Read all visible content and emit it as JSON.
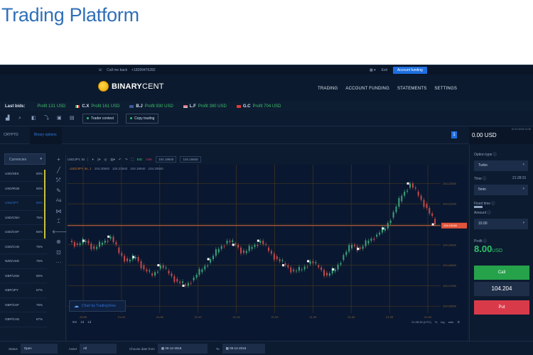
{
  "page_title": "Trading Platform",
  "topbar": {
    "call_label": "Call me back",
    "phone": "+18299476282",
    "exit_label": "Exit",
    "account_funding_button": "Account funding"
  },
  "brand": {
    "name_bold": "BINARY",
    "name_light": "CENT"
  },
  "nav": [
    "TRADING",
    "ACCOUNT FUNDING",
    "STATEMENTS",
    "SETTINGS"
  ],
  "last_bids": {
    "label": "Last bids:",
    "items": [
      {
        "name": "",
        "text": "Profit 131 USD",
        "flag": ""
      },
      {
        "name": "C.X",
        "text": "Profit 161 USD",
        "flag": "#e8ded0"
      },
      {
        "name": "B.J",
        "text": "Profit 930 USD",
        "flag": "#3b5998"
      },
      {
        "name": "L.F",
        "text": "Profit 390 USD",
        "flag": "#c5364a"
      },
      {
        "name": "G.C",
        "text": "Profit 704 USD",
        "flag": "#e03a3a"
      }
    ]
  },
  "toolbar": {
    "trader_contest": "Trader contest",
    "copy_trading": "Copy trading"
  },
  "tabs": [
    "CRYPTO",
    "Binary options"
  ],
  "balance": {
    "amount": "0.00 USD",
    "badge": "1",
    "date": "02.10.2018 21:28"
  },
  "currencies": {
    "selector": "Currencies",
    "items": [
      {
        "pair": "USD/SEK",
        "pct": "60%"
      },
      {
        "pair": "USD/RUB",
        "pct": "50%"
      },
      {
        "pair": "USD/JPY",
        "pct": "80%",
        "active": true
      },
      {
        "pair": "USD/CNH",
        "pct": "75%"
      },
      {
        "pair": "USD/CHF",
        "pct": "65%"
      },
      {
        "pair": "USD/CAD",
        "pct": "75%"
      },
      {
        "pair": "NZD/USD",
        "pct": "75%"
      },
      {
        "pair": "GBP/USD",
        "pct": "80%"
      },
      {
        "pair": "GBP/JPY",
        "pct": "67%"
      },
      {
        "pair": "GBP/CHF",
        "pct": "75%"
      },
      {
        "pair": "GBP/CAD",
        "pct": "67%"
      }
    ]
  },
  "chart_toolbar": {
    "symbol": "USDJPY, 5s",
    "buy": "BID",
    "sell": "ASK",
    "v1": "104.19840",
    "v2": "104.16840"
  },
  "chart_legend": {
    "symbol": "USD/JPY, 5s, 1",
    "o": "104.20840",
    "h": "104.21840",
    "l": "104.19940",
    "c": "104.20840"
  },
  "current_price_label": "104.19940",
  "chart_footer": {
    "tradingview": "Chart by TradingView",
    "timeframes": [
      "5m",
      "1d",
      "1d"
    ],
    "utc": "21:28:30 (UTC)",
    "pct": "%",
    "log": "log",
    "auto": "auto"
  },
  "right_panel": {
    "option_type_label": "Option type",
    "option_type": "Turbo",
    "time_label": "Time",
    "time_clock": "21:28:31",
    "time_value": "5min",
    "fixed_time_label": "Fixed time",
    "amount_label": "Amount",
    "amount_value": "10.00",
    "profit_label": "Profit",
    "profit_value": "8.00",
    "profit_currency": "USD",
    "call_button": "Call",
    "price": "104.204",
    "put_button": "Put"
  },
  "bottom_filters": {
    "status_label": "Status",
    "status_value": "Open",
    "asset_label": "Asset",
    "asset_value": "All",
    "date_from_label": "Choose date from",
    "date_from": "09-12-2018",
    "to_label": "To",
    "date_to": "09-12-2018"
  },
  "chart_data": {
    "type": "candlestick",
    "symbol": "USD/JPY",
    "y_ticks": [
      "104.22000",
      "104.21000",
      "104.20000",
      "104.19000",
      "104.18000",
      "104.17000",
      "104.16000"
    ],
    "x_ticks": [
      "20:55",
      "21:00",
      "21:05",
      "21:10",
      "21:15",
      "21:20",
      "21:25",
      "21:30",
      "21:35",
      "21:40"
    ],
    "current_price": 104.1994,
    "closes": [
      104.19,
      104.192,
      104.188,
      104.191,
      104.194,
      104.186,
      104.182,
      104.184,
      104.178,
      104.175,
      104.18,
      104.176,
      104.172,
      104.17,
      104.174,
      104.178,
      104.183,
      104.188,
      104.192,
      104.19,
      104.186,
      104.189,
      104.192,
      104.187,
      104.183,
      104.18,
      104.177,
      104.178,
      104.182,
      104.179,
      104.175,
      104.178,
      104.185,
      104.19,
      104.188,
      104.192,
      104.195,
      104.198,
      104.206,
      104.214,
      104.22,
      104.214,
      104.208,
      104.2
    ]
  }
}
